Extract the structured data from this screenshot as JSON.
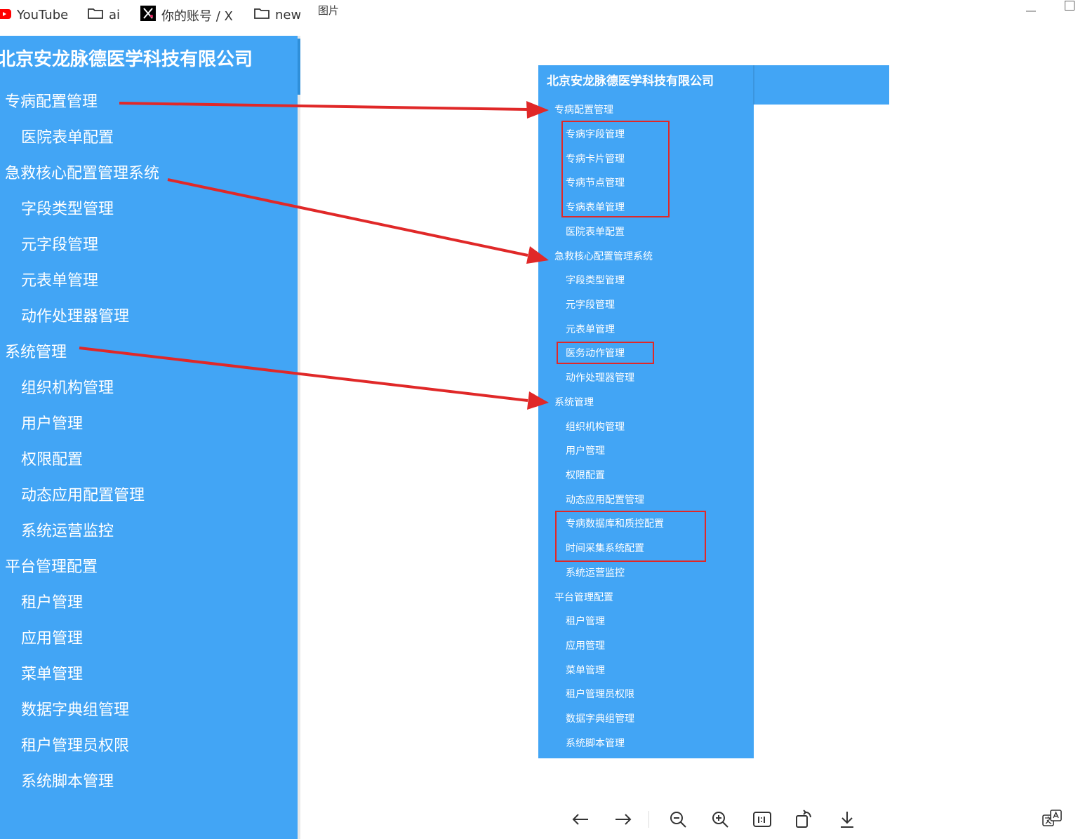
{
  "bookmarks": [
    {
      "label": "YouTube",
      "icon": "youtube-icon"
    },
    {
      "label": "ai",
      "icon": "folder-icon"
    },
    {
      "label": "你的账号 / X",
      "icon": "x-logo-icon"
    },
    {
      "label": "new",
      "icon": "folder-icon"
    }
  ],
  "left_sidebar": {
    "title": "北京安龙脉德医学科技有限公司",
    "items": [
      {
        "label": "专病配置管理",
        "level": 1
      },
      {
        "label": "医院表单配置",
        "level": 2
      },
      {
        "label": "急救核心配置管理系统",
        "level": 1
      },
      {
        "label": "字段类型管理",
        "level": 2
      },
      {
        "label": "元字段管理",
        "level": 2
      },
      {
        "label": "元表单管理",
        "level": 2
      },
      {
        "label": "动作处理器管理",
        "level": 2
      },
      {
        "label": "系统管理",
        "level": 1
      },
      {
        "label": "组织机构管理",
        "level": 2
      },
      {
        "label": "用户管理",
        "level": 2
      },
      {
        "label": "权限配置",
        "level": 2
      },
      {
        "label": "动态应用配置管理",
        "level": 2
      },
      {
        "label": "系统运营监控",
        "level": 2
      },
      {
        "label": "平台管理配置",
        "level": 1
      },
      {
        "label": "租户管理",
        "level": 2
      },
      {
        "label": "应用管理",
        "level": 2
      },
      {
        "label": "菜单管理",
        "level": 2
      },
      {
        "label": "数据字典组管理",
        "level": 2
      },
      {
        "label": "租户管理员权限",
        "level": 2
      },
      {
        "label": "系统脚本管理",
        "level": 2
      }
    ]
  },
  "viewer": {
    "title": "图片",
    "image": {
      "title": "北京安龙脉德医学科技有限公司",
      "items": [
        {
          "label": "专病配置管理",
          "level": 1
        },
        {
          "label": "专病字段管理",
          "level": 2
        },
        {
          "label": "专病卡片管理",
          "level": 2
        },
        {
          "label": "专病节点管理",
          "level": 2
        },
        {
          "label": "专病表单管理",
          "level": 2
        },
        {
          "label": "医院表单配置",
          "level": 2
        },
        {
          "label": "急救核心配置管理系统",
          "level": 1
        },
        {
          "label": "字段类型管理",
          "level": 2
        },
        {
          "label": "元字段管理",
          "level": 2
        },
        {
          "label": "元表单管理",
          "level": 2
        },
        {
          "label": "医务动作管理",
          "level": 2
        },
        {
          "label": "动作处理器管理",
          "level": 2
        },
        {
          "label": "系统管理",
          "level": 1
        },
        {
          "label": "组织机构管理",
          "level": 2
        },
        {
          "label": "用户管理",
          "level": 2
        },
        {
          "label": "权限配置",
          "level": 2
        },
        {
          "label": "动态应用配置管理",
          "level": 2
        },
        {
          "label": "专病数据库和质控配置",
          "level": 2
        },
        {
          "label": "时间采集系统配置",
          "level": 2
        },
        {
          "label": "系统运营监控",
          "level": 2
        },
        {
          "label": "平台管理配置",
          "level": 1
        },
        {
          "label": "租户管理",
          "level": 2
        },
        {
          "label": "应用管理",
          "level": 2
        },
        {
          "label": "菜单管理",
          "level": 2
        },
        {
          "label": "租户管理员权限",
          "level": 2
        },
        {
          "label": "数据字典组管理",
          "level": 2
        },
        {
          "label": "系统脚本管理",
          "level": 2
        }
      ]
    },
    "toolbar": [
      "arrow-left-icon",
      "arrow-right-icon",
      "zoom-out-icon",
      "zoom-in-icon",
      "actual-size-icon",
      "rotate-icon",
      "download-icon",
      "translate-icon"
    ]
  },
  "colors": {
    "sidebar_blue": "#42a5f5",
    "highlight_red": "#e02828"
  }
}
